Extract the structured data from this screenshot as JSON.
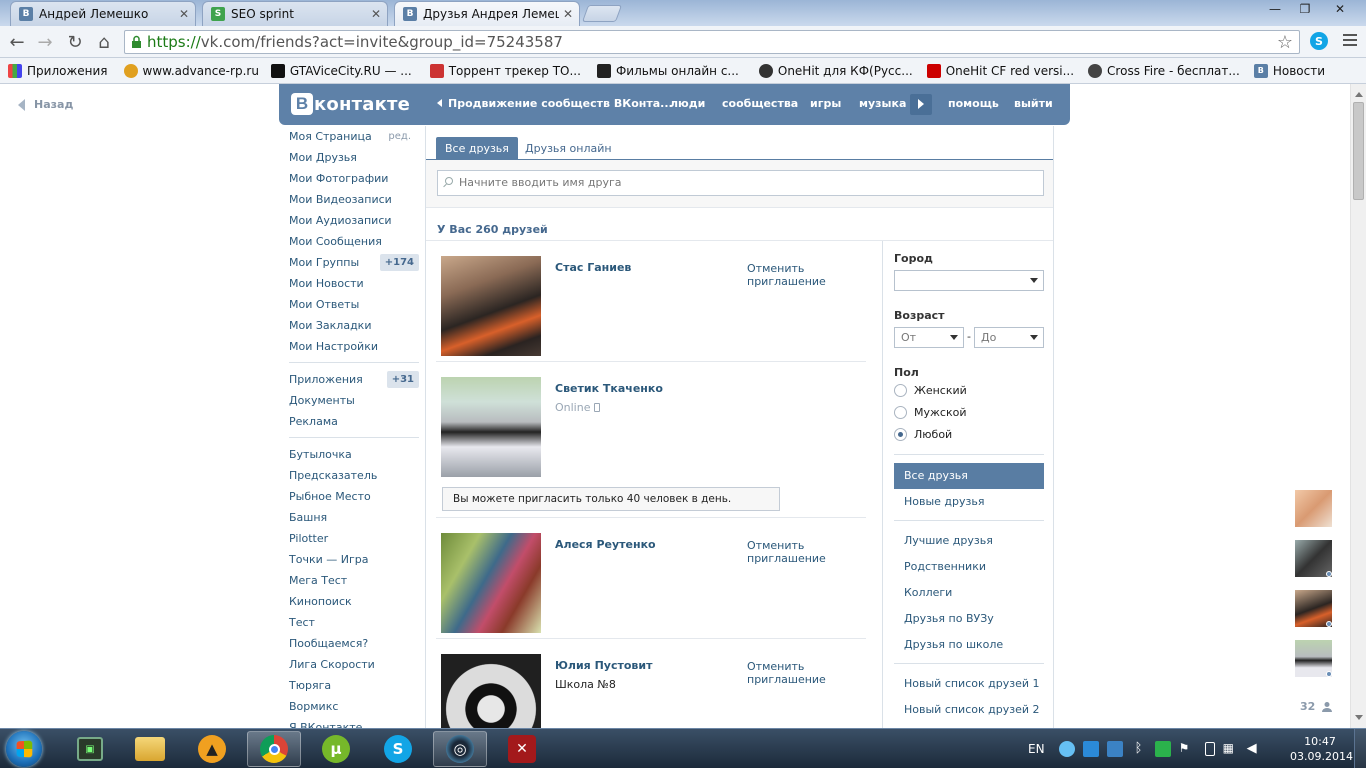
{
  "browser": {
    "tabs": [
      {
        "title": "Андрей Лемешко",
        "favicon": "vk-favicon",
        "active": false
      },
      {
        "title": "SEO sprint",
        "favicon": "seosprint-favicon",
        "active": false
      },
      {
        "title": "Друзья Андрея Лемешко",
        "favicon": "vk-favicon",
        "active": true
      }
    ],
    "url_scheme": "https://",
    "url_rest": "vk.com/friends?act=invite&group_id=75243587",
    "bookmarks": [
      {
        "label": "Приложения",
        "icon": "apps-grid-icon"
      },
      {
        "label": "www.advance-rp.ru",
        "icon": "advance-rp-icon"
      },
      {
        "label": "GTAViceCity.RU — ...",
        "icon": "gta-icon"
      },
      {
        "label": "Торрент трекер ТО...",
        "icon": "torrent-icon"
      },
      {
        "label": "Фильмы онлайн с...",
        "icon": "clapper-icon"
      },
      {
        "label": "OneHit для КФ(Русс...",
        "icon": "onehit-icon"
      },
      {
        "label": "OneHit CF red versi...",
        "icon": "onehit-red-icon"
      },
      {
        "label": "Cross Fire - бесплат...",
        "icon": "crossfire-icon"
      },
      {
        "label": "Новости",
        "icon": "vk-favicon"
      }
    ]
  },
  "vk": {
    "back_label": "Назад",
    "logo_text": "контакте",
    "logo_letter": "В",
    "header_nav": {
      "promo": "Продвижение сообществ ВКонта...",
      "people": "люди",
      "communities": "сообщества",
      "games": "игры",
      "music": "музыка",
      "help": "помощь",
      "logout": "выйти"
    },
    "left_menu": [
      {
        "label": "Моя Страница",
        "extra": "ред."
      },
      {
        "label": "Мои Друзья"
      },
      {
        "label": "Мои Фотографии"
      },
      {
        "label": "Мои Видеозаписи"
      },
      {
        "label": "Мои Аудиозаписи"
      },
      {
        "label": "Мои Сообщения"
      },
      {
        "label": "Мои Группы",
        "count": "+174"
      },
      {
        "label": "Мои Новости"
      },
      {
        "label": "Мои Ответы"
      },
      {
        "label": "Мои Закладки"
      },
      {
        "label": "Мои Настройки"
      }
    ],
    "left_menu_2": [
      {
        "label": "Приложения",
        "count": "+31"
      },
      {
        "label": "Документы"
      },
      {
        "label": "Реклама"
      }
    ],
    "apps": [
      "Бутылочка",
      "Предсказатель",
      "Рыбное Место",
      "Башня",
      "Pilotter",
      "Точки — Игра",
      "Мега Тест",
      "Кинопоиск",
      "Тест",
      "Пообщаемся?",
      "Лига Скорости",
      "Тюряга",
      "Вормикс",
      "Я ВКонтакте"
    ],
    "friends_tabs": {
      "all": "Все друзья",
      "online": "Друзья онлайн"
    },
    "search_placeholder": "Начните вводить имя друга",
    "summary": "У Вас 260 друзей",
    "friends": [
      {
        "name": "Стас Ганиев",
        "sub": "",
        "action": [
          "Отменить",
          "приглашение"
        ]
      },
      {
        "name": "Светик Ткаченко",
        "sub": "Online",
        "action": []
      },
      {
        "name": "Алеся Реутенко",
        "sub": "",
        "action": [
          "Отменить",
          "приглашение"
        ]
      },
      {
        "name": "Юлия Пустовит",
        "sub": "Школа №8",
        "action": [
          "Отменить",
          "приглашение"
        ]
      }
    ],
    "invite_notice": "Вы можете пригласить только 40 человек в день.",
    "filters": {
      "city_label": "Город",
      "city_value": "",
      "age_label": "Возраст",
      "age_from": "От",
      "age_dash": "-",
      "age_to": "До",
      "gender_label": "Пол",
      "gender_options": [
        "Женский",
        "Мужской",
        "Любой"
      ],
      "gender_selected": "Любой"
    },
    "lists": [
      "Все друзья",
      "Новые друзья"
    ],
    "lists_2": [
      "Лучшие друзья",
      "Родственники",
      "Коллеги",
      "Друзья по ВУЗу",
      "Друзья по школе"
    ],
    "lists_3": [
      "Новый список друзей 1",
      "Новый список друзей 2"
    ],
    "chat_count": "32",
    "colors": {
      "accent": "#597da3",
      "header": "#5e81a8",
      "link": "#2b587a"
    }
  },
  "taskbar": {
    "apps": [
      "explorer-icon",
      "libraries-icon",
      "aimp-icon",
      "chrome-icon",
      "utorrent-icon",
      "skype-icon",
      "steam-icon",
      "dota2-icon"
    ],
    "lang": "EN",
    "time": "10:47",
    "date": "03.09.2014"
  }
}
